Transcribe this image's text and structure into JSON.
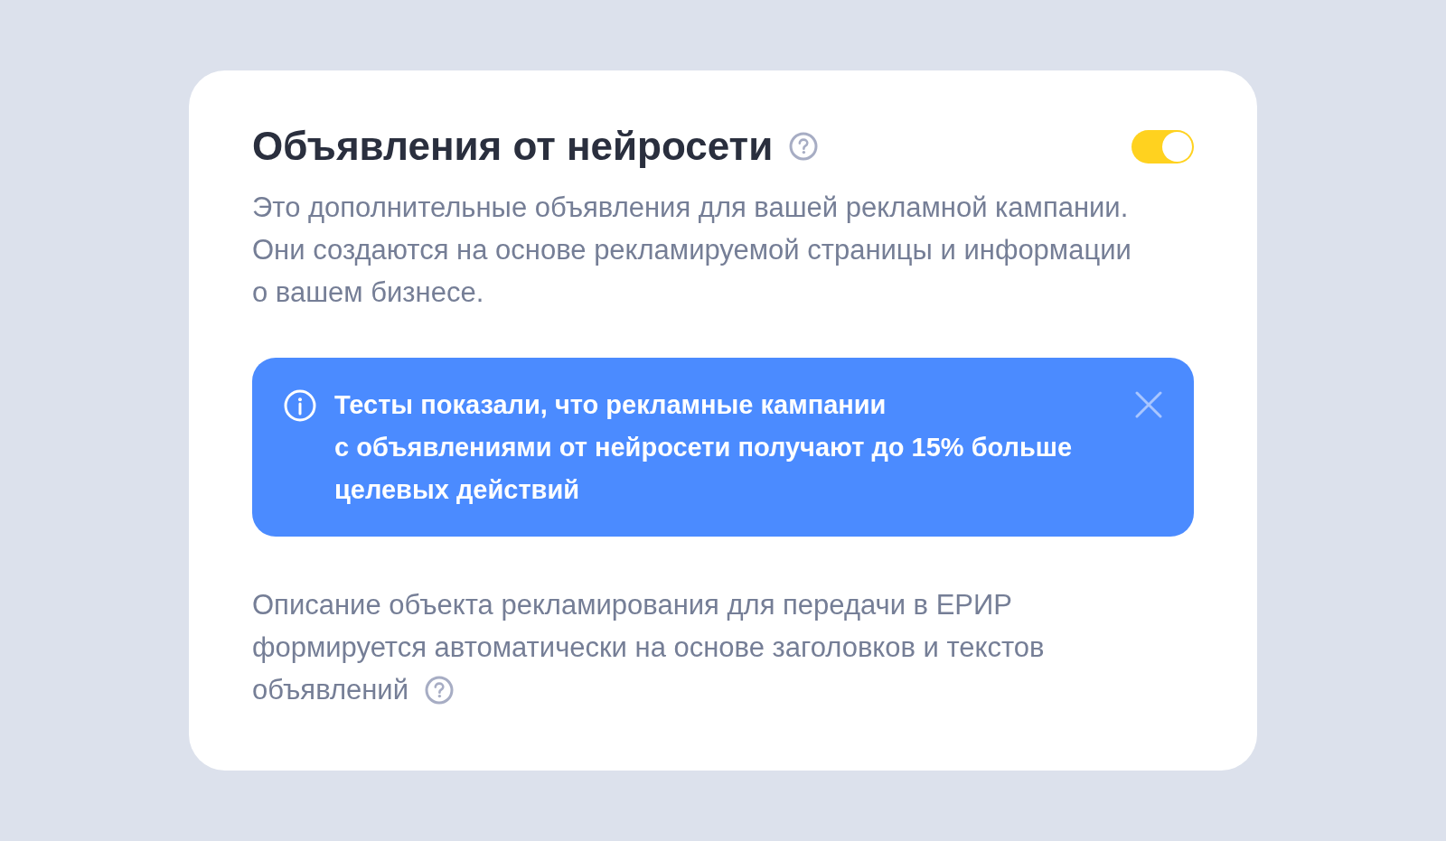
{
  "section": {
    "title": "Объявления от нейросети",
    "toggle_on": true,
    "description": "Это дополнительные объявления для вашей рекламной кампании.\nОни создаются на основе рекламируемой страницы и информации\nо вашем бизнесе."
  },
  "banner": {
    "text": "Тесты показали, что рекламные кампании\nс объявлениями от нейросети получают до 15% больше\nцелевых действий"
  },
  "note": {
    "lines": [
      "Описание объекта рекламирования для передачи в ЕРИР",
      "формируется автоматически на основе заголовков и текстов",
      "объявлений"
    ]
  }
}
